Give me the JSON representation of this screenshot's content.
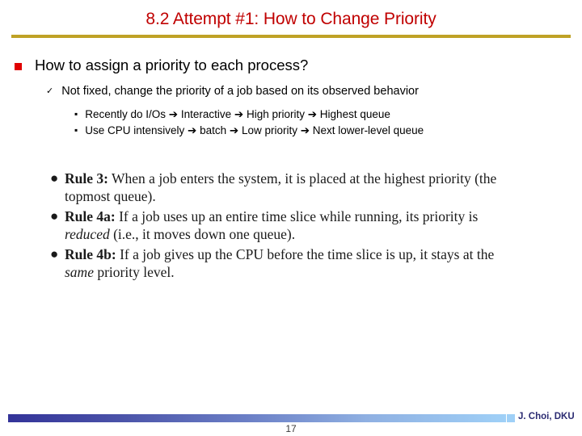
{
  "slide": {
    "title": "8.2 Attempt #1: How to Change Priority",
    "title_color": "#c00000",
    "rule_color": "#bfa226"
  },
  "content": {
    "level1": {
      "marker": "square-bullet",
      "text": "How to assign a priority to each process?",
      "marker_color": "#e00000"
    },
    "level2": {
      "marker": "✓",
      "text": "Not fixed, change the priority of a job based on its observed behavior"
    },
    "level3": [
      {
        "marker": "▪",
        "segments": [
          "Recently do I/Os ",
          "➔",
          " Interactive ",
          "➔",
          " High priority ",
          "➔",
          " Highest queue"
        ],
        "plain": "Recently do I/Os ➔ Interactive ➔ High priority ➔ Highest queue"
      },
      {
        "marker": "▪",
        "segments": [
          "Use CPU intensively ",
          "➔",
          " batch ",
          "➔",
          " Low priority ",
          "➔",
          " Next lower-level queue"
        ],
        "plain": "Use CPU intensively ➔ batch ➔ Low priority ➔ Next lower-level queue"
      }
    ]
  },
  "rules": {
    "bullet": "●",
    "items": [
      {
        "name": "Rule 3:",
        "body_1": " When a job enters the system, it is placed at the highest priority (the topmost queue).",
        "italic": "",
        "body_2": ""
      },
      {
        "name": "Rule 4a:",
        "body_1": " If a job uses up an entire time slice while running, its priority is ",
        "italic": "reduced",
        "body_2": " (i.e., it moves down one queue)."
      },
      {
        "name": "Rule 4b:",
        "body_1": " If a job gives up the CPU before the time slice is up, it stays at the ",
        "italic": "same",
        "body_2": " priority level."
      }
    ]
  },
  "footer": {
    "credit": "J. Choi, DKU",
    "page_number": "17",
    "gradient_start": "#333399",
    "gradient_end": "#9fd0f7",
    "credit_color": "#2b2b72"
  }
}
